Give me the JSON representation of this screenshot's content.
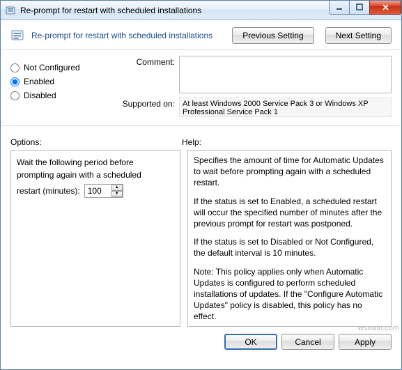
{
  "titlebar": {
    "title": "Re-prompt for restart with scheduled installations"
  },
  "header": {
    "title": "Re-prompt for restart with scheduled installations",
    "prev_btn": "Previous Setting",
    "next_btn": "Next Setting"
  },
  "radios": {
    "not_configured": "Not Configured",
    "enabled": "Enabled",
    "disabled": "Disabled",
    "selected": "enabled"
  },
  "fields": {
    "comment_label": "Comment:",
    "comment_value": "",
    "supported_label": "Supported on:",
    "supported_value": "At least Windows 2000 Service Pack 3 or Windows XP Professional Service Pack 1"
  },
  "sections": {
    "options_label": "Options:",
    "help_label": "Help:"
  },
  "options": {
    "line1": "Wait the following period before",
    "line2": "prompting again with a scheduled",
    "restart_label": "restart (minutes):",
    "restart_value": "100"
  },
  "help": {
    "p1": "Specifies the amount of time for Automatic Updates to wait before prompting again with a scheduled restart.",
    "p2": "If the status is set to Enabled, a scheduled restart will occur the specified number of minutes after the previous prompt for restart was postponed.",
    "p3": "If the status is set to Disabled or Not Configured, the default interval is 10 minutes.",
    "p4": "Note: This policy applies only when Automatic Updates is configured to perform scheduled installations of updates. If the \"Configure Automatic Updates\" policy is disabled, this policy has no effect."
  },
  "footer": {
    "ok": "OK",
    "cancel": "Cancel",
    "apply": "Apply"
  },
  "watermark": "wsxwin.com"
}
